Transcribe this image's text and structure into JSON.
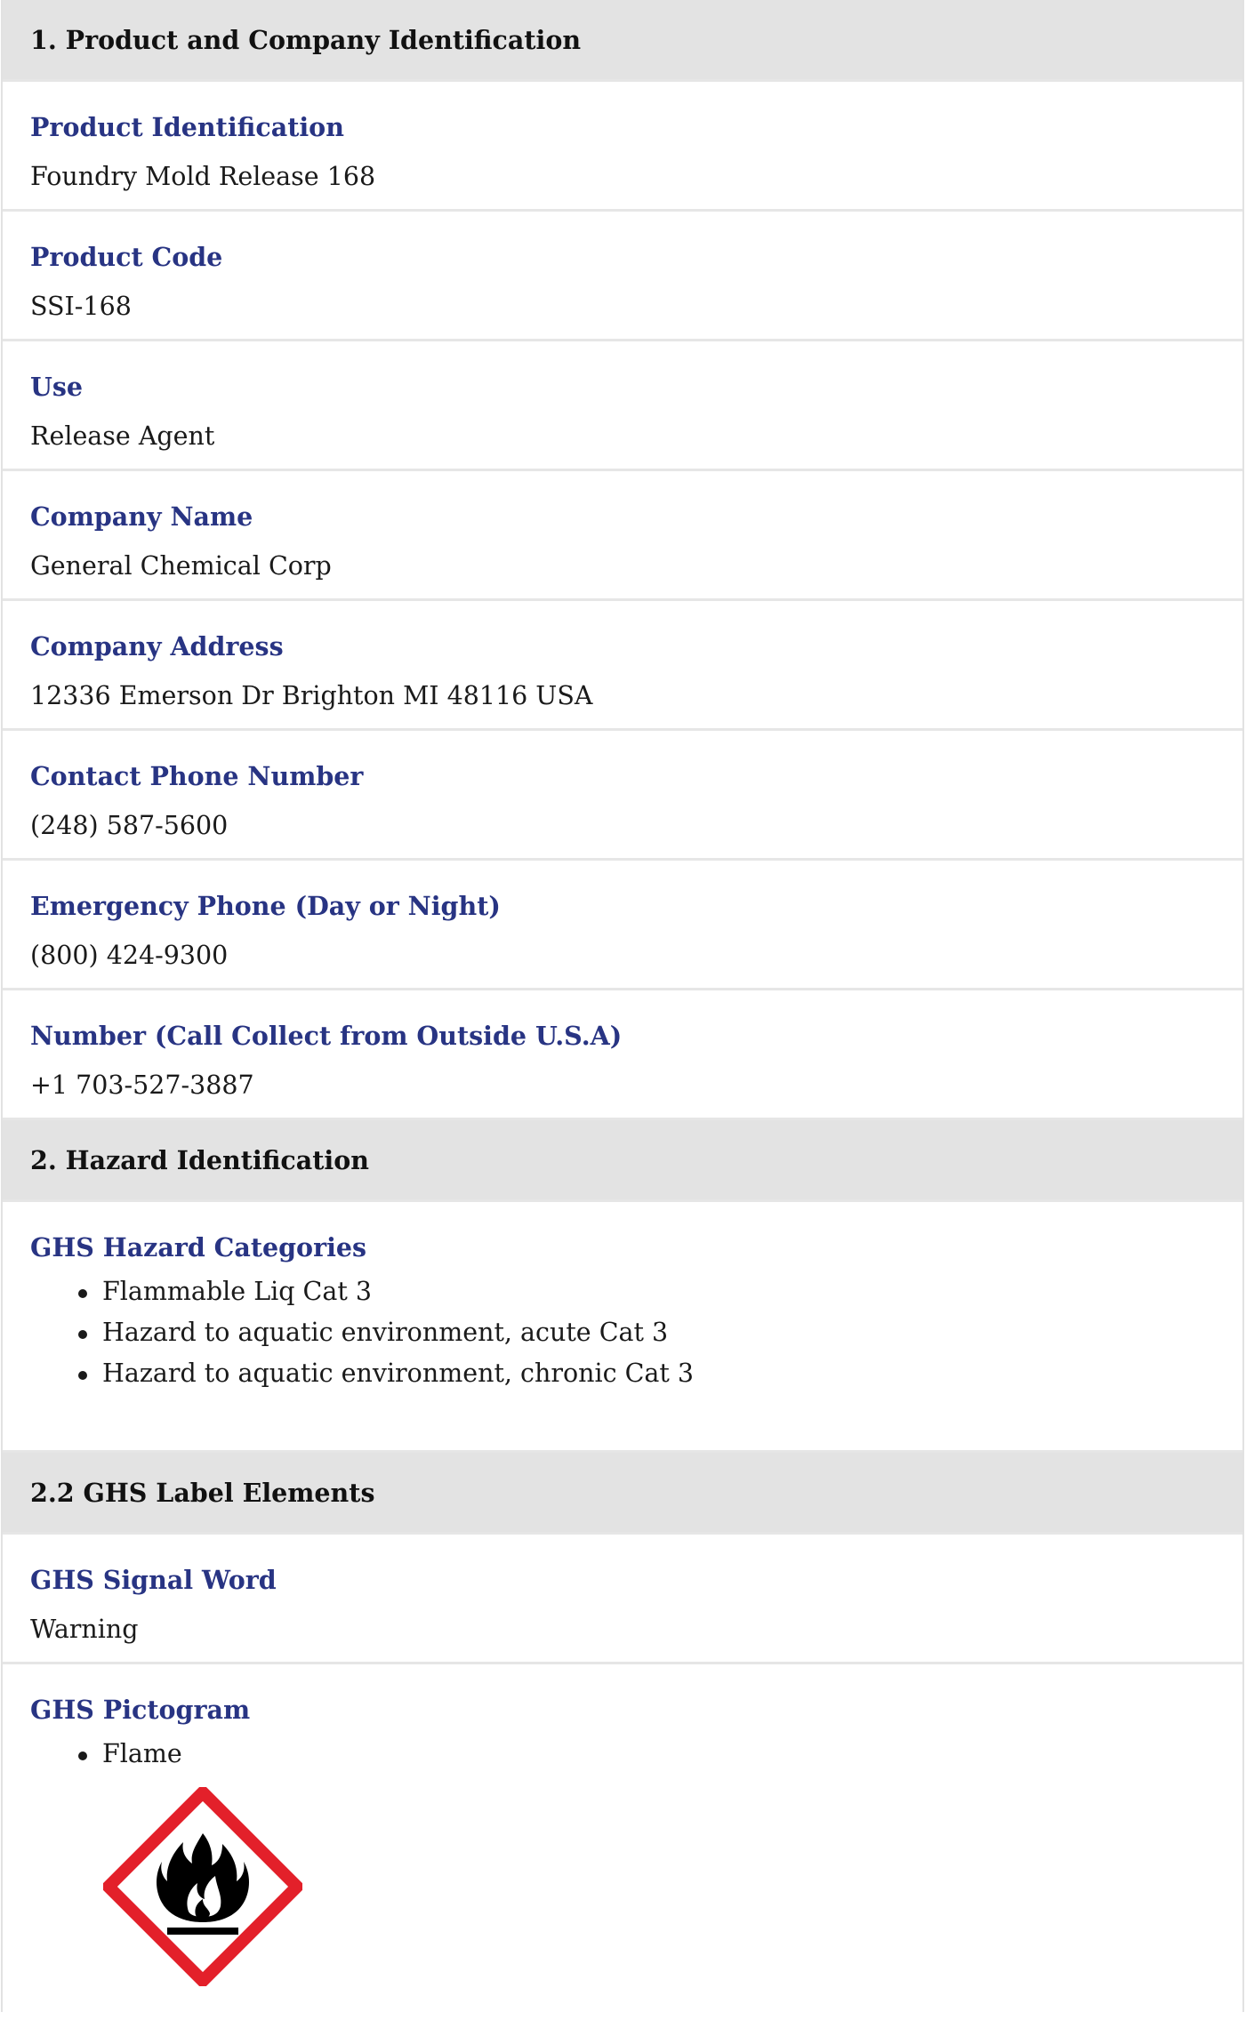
{
  "sections": [
    {
      "title": "1. Product and Company Identification",
      "fields": [
        {
          "label": "Product Identification",
          "value": "Foundry Mold Release 168"
        },
        {
          "label": "Product Code",
          "value": "SSI-168"
        },
        {
          "label": "Use",
          "value": "Release Agent"
        },
        {
          "label": "Company Name",
          "value": "General Chemical Corp"
        },
        {
          "label": "Company Address",
          "value": "12336 Emerson Dr Brighton MI 48116 USA"
        },
        {
          "label": "Contact Phone Number",
          "value": "(248) 587-5600"
        },
        {
          "label": "Emergency Phone (Day or Night)",
          "value": "(800) 424-9300"
        },
        {
          "label": "Number (Call Collect from Outside U.S.A)",
          "value": "+1 703-527-3887"
        }
      ]
    },
    {
      "title": "2. Hazard Identification",
      "fields": [
        {
          "label": "GHS Hazard Categories",
          "items": [
            "Flammable Liq Cat 3",
            "Hazard to aquatic environment, acute Cat 3",
            "Hazard to aquatic environment, chronic Cat 3"
          ]
        }
      ]
    },
    {
      "title": "2.2 GHS Label Elements",
      "fields": [
        {
          "label": "GHS Signal Word",
          "value": "Warning"
        },
        {
          "label": "GHS Pictogram",
          "items": [
            "Flame"
          ],
          "pictogram": {
            "icon": "ghs-flame-icon",
            "border_color": "#e3202a",
            "symbol_color": "#000000"
          }
        }
      ]
    }
  ]
}
